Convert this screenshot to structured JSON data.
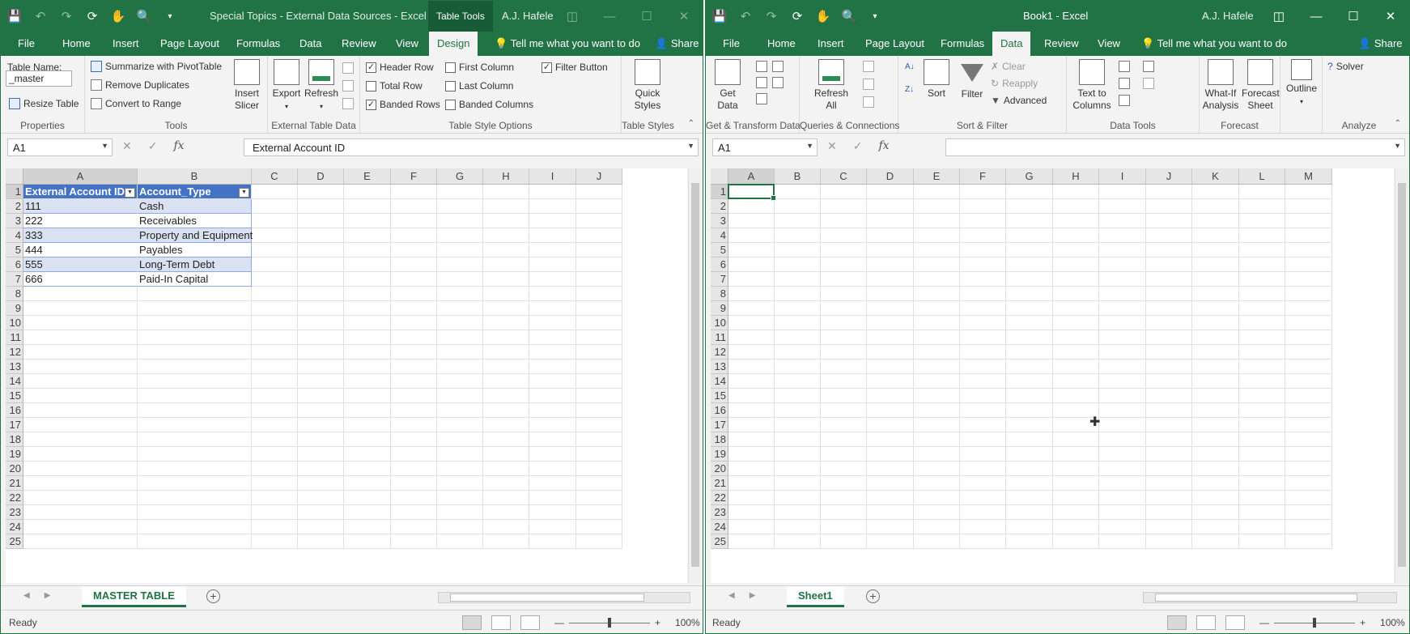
{
  "left": {
    "title": "Special Topics - External Data Sources  -  Excel",
    "context_tab": "Table Tools",
    "user": "A.J. Hafele",
    "tabs": [
      "File",
      "Home",
      "Insert",
      "Page Layout",
      "Formulas",
      "Data",
      "Review",
      "View",
      "Design"
    ],
    "selected_tab": "Design",
    "tell_me": "Tell me what you want to do",
    "share": "Share",
    "ribbon": {
      "properties": {
        "table_name_label": "Table Name:",
        "table_name_value": "_master",
        "resize": "Resize Table",
        "label": "Properties"
      },
      "tools": {
        "pivot": "Summarize with PivotTable",
        "dupes": "Remove Duplicates",
        "convert": "Convert to Range",
        "slicer": "Insert Slicer",
        "label": "Tools"
      },
      "external": {
        "export": "Export",
        "refresh": "Refresh",
        "label": "External Table Data"
      },
      "options": {
        "header_row": "Header Row",
        "total_row": "Total Row",
        "banded_rows": "Banded Rows",
        "first_col": "First Column",
        "last_col": "Last Column",
        "banded_cols": "Banded Columns",
        "filter_btn": "Filter Button",
        "label": "Table Style Options"
      },
      "styles": {
        "quick": "Quick Styles",
        "label": "Table Styles"
      }
    },
    "name_box": "A1",
    "formula": "External Account ID",
    "columns": [
      "A",
      "B",
      "C",
      "D",
      "E",
      "F",
      "G",
      "H",
      "I",
      "J"
    ],
    "rows": [
      "1",
      "2",
      "3",
      "4",
      "5",
      "6",
      "7",
      "8",
      "9",
      "10",
      "11",
      "12",
      "13",
      "14",
      "15",
      "16",
      "17",
      "18",
      "19",
      "20",
      "21",
      "22",
      "23",
      "24",
      "25"
    ],
    "table": {
      "headers": [
        "External Account ID",
        "Account_Type"
      ],
      "data": [
        [
          "111",
          "Cash"
        ],
        [
          "222",
          "Receivables"
        ],
        [
          "333",
          "Property and Equipment"
        ],
        [
          "444",
          "Payables"
        ],
        [
          "555",
          "Long-Term Debt"
        ],
        [
          "666",
          "Paid-In Capital"
        ]
      ]
    },
    "sheet_tab": "MASTER TABLE",
    "status": "Ready",
    "zoom": "100%"
  },
  "right": {
    "title": "Book1  -  Excel",
    "user": "A.J. Hafele",
    "tabs": [
      "File",
      "Home",
      "Insert",
      "Page Layout",
      "Formulas",
      "Data",
      "Review",
      "View"
    ],
    "selected_tab": "Data",
    "tell_me": "Tell me what you want to do",
    "share": "Share",
    "ribbon": {
      "get_data": "Get Data",
      "gt_label": "Get & Transform Data",
      "refresh_all": "Refresh All",
      "qc_label": "Queries & Connections",
      "sort": "Sort",
      "filter": "Filter",
      "clear": "Clear",
      "reapply": "Reapply",
      "advanced": "Advanced",
      "sf_label": "Sort & Filter",
      "text_to_cols": "Text to Columns",
      "dt_label": "Data Tools",
      "whatif": "What-If Analysis",
      "forecast_sheet": "Forecast Sheet",
      "fc_label": "Forecast",
      "outline": "Outline",
      "solver": "Solver",
      "an_label": "Analyze"
    },
    "name_box": "A1",
    "formula": "",
    "columns": [
      "A",
      "B",
      "C",
      "D",
      "E",
      "F",
      "G",
      "H",
      "I",
      "J",
      "K",
      "L",
      "M"
    ],
    "rows": [
      "1",
      "2",
      "3",
      "4",
      "5",
      "6",
      "7",
      "8",
      "9",
      "10",
      "11",
      "12",
      "13",
      "14",
      "15",
      "16",
      "17",
      "18",
      "19",
      "20",
      "21",
      "22",
      "23",
      "24",
      "25"
    ],
    "sheet_tab": "Sheet1",
    "status": "Ready",
    "zoom": "100%"
  },
  "colors": {
    "excel_green": "#217346",
    "table_header": "#4472c4",
    "band": "#d9e1f2"
  }
}
